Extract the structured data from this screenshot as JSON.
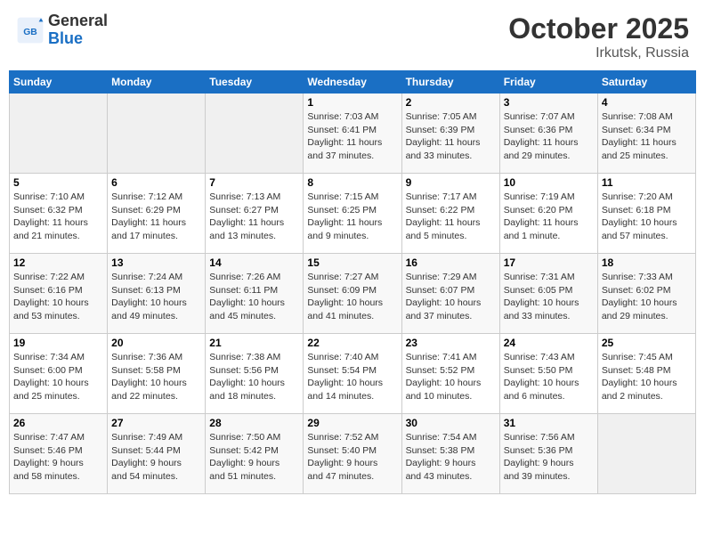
{
  "header": {
    "logo_general": "General",
    "logo_blue": "Blue",
    "month": "October 2025",
    "location": "Irkutsk, Russia"
  },
  "days_of_week": [
    "Sunday",
    "Monday",
    "Tuesday",
    "Wednesday",
    "Thursday",
    "Friday",
    "Saturday"
  ],
  "weeks": [
    [
      {
        "day": "",
        "info": ""
      },
      {
        "day": "",
        "info": ""
      },
      {
        "day": "",
        "info": ""
      },
      {
        "day": "1",
        "info": "Sunrise: 7:03 AM\nSunset: 6:41 PM\nDaylight: 11 hours\nand 37 minutes."
      },
      {
        "day": "2",
        "info": "Sunrise: 7:05 AM\nSunset: 6:39 PM\nDaylight: 11 hours\nand 33 minutes."
      },
      {
        "day": "3",
        "info": "Sunrise: 7:07 AM\nSunset: 6:36 PM\nDaylight: 11 hours\nand 29 minutes."
      },
      {
        "day": "4",
        "info": "Sunrise: 7:08 AM\nSunset: 6:34 PM\nDaylight: 11 hours\nand 25 minutes."
      }
    ],
    [
      {
        "day": "5",
        "info": "Sunrise: 7:10 AM\nSunset: 6:32 PM\nDaylight: 11 hours\nand 21 minutes."
      },
      {
        "day": "6",
        "info": "Sunrise: 7:12 AM\nSunset: 6:29 PM\nDaylight: 11 hours\nand 17 minutes."
      },
      {
        "day": "7",
        "info": "Sunrise: 7:13 AM\nSunset: 6:27 PM\nDaylight: 11 hours\nand 13 minutes."
      },
      {
        "day": "8",
        "info": "Sunrise: 7:15 AM\nSunset: 6:25 PM\nDaylight: 11 hours\nand 9 minutes."
      },
      {
        "day": "9",
        "info": "Sunrise: 7:17 AM\nSunset: 6:22 PM\nDaylight: 11 hours\nand 5 minutes."
      },
      {
        "day": "10",
        "info": "Sunrise: 7:19 AM\nSunset: 6:20 PM\nDaylight: 11 hours\nand 1 minute."
      },
      {
        "day": "11",
        "info": "Sunrise: 7:20 AM\nSunset: 6:18 PM\nDaylight: 10 hours\nand 57 minutes."
      }
    ],
    [
      {
        "day": "12",
        "info": "Sunrise: 7:22 AM\nSunset: 6:16 PM\nDaylight: 10 hours\nand 53 minutes."
      },
      {
        "day": "13",
        "info": "Sunrise: 7:24 AM\nSunset: 6:13 PM\nDaylight: 10 hours\nand 49 minutes."
      },
      {
        "day": "14",
        "info": "Sunrise: 7:26 AM\nSunset: 6:11 PM\nDaylight: 10 hours\nand 45 minutes."
      },
      {
        "day": "15",
        "info": "Sunrise: 7:27 AM\nSunset: 6:09 PM\nDaylight: 10 hours\nand 41 minutes."
      },
      {
        "day": "16",
        "info": "Sunrise: 7:29 AM\nSunset: 6:07 PM\nDaylight: 10 hours\nand 37 minutes."
      },
      {
        "day": "17",
        "info": "Sunrise: 7:31 AM\nSunset: 6:05 PM\nDaylight: 10 hours\nand 33 minutes."
      },
      {
        "day": "18",
        "info": "Sunrise: 7:33 AM\nSunset: 6:02 PM\nDaylight: 10 hours\nand 29 minutes."
      }
    ],
    [
      {
        "day": "19",
        "info": "Sunrise: 7:34 AM\nSunset: 6:00 PM\nDaylight: 10 hours\nand 25 minutes."
      },
      {
        "day": "20",
        "info": "Sunrise: 7:36 AM\nSunset: 5:58 PM\nDaylight: 10 hours\nand 22 minutes."
      },
      {
        "day": "21",
        "info": "Sunrise: 7:38 AM\nSunset: 5:56 PM\nDaylight: 10 hours\nand 18 minutes."
      },
      {
        "day": "22",
        "info": "Sunrise: 7:40 AM\nSunset: 5:54 PM\nDaylight: 10 hours\nand 14 minutes."
      },
      {
        "day": "23",
        "info": "Sunrise: 7:41 AM\nSunset: 5:52 PM\nDaylight: 10 hours\nand 10 minutes."
      },
      {
        "day": "24",
        "info": "Sunrise: 7:43 AM\nSunset: 5:50 PM\nDaylight: 10 hours\nand 6 minutes."
      },
      {
        "day": "25",
        "info": "Sunrise: 7:45 AM\nSunset: 5:48 PM\nDaylight: 10 hours\nand 2 minutes."
      }
    ],
    [
      {
        "day": "26",
        "info": "Sunrise: 7:47 AM\nSunset: 5:46 PM\nDaylight: 9 hours\nand 58 minutes."
      },
      {
        "day": "27",
        "info": "Sunrise: 7:49 AM\nSunset: 5:44 PM\nDaylight: 9 hours\nand 54 minutes."
      },
      {
        "day": "28",
        "info": "Sunrise: 7:50 AM\nSunset: 5:42 PM\nDaylight: 9 hours\nand 51 minutes."
      },
      {
        "day": "29",
        "info": "Sunrise: 7:52 AM\nSunset: 5:40 PM\nDaylight: 9 hours\nand 47 minutes."
      },
      {
        "day": "30",
        "info": "Sunrise: 7:54 AM\nSunset: 5:38 PM\nDaylight: 9 hours\nand 43 minutes."
      },
      {
        "day": "31",
        "info": "Sunrise: 7:56 AM\nSunset: 5:36 PM\nDaylight: 9 hours\nand 39 minutes."
      },
      {
        "day": "",
        "info": ""
      }
    ]
  ]
}
